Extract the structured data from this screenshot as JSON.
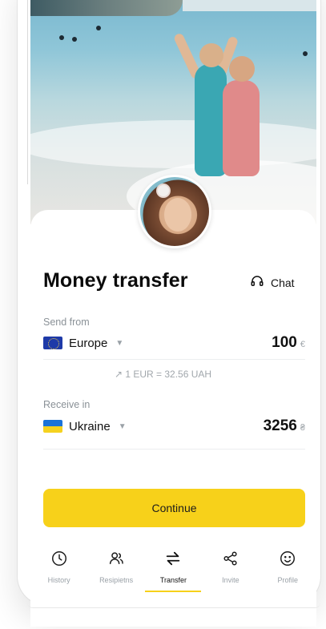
{
  "screen": {
    "title": "Money transfer",
    "chat_label": "Chat"
  },
  "send": {
    "label": "Send from",
    "region": "Europe",
    "amount": "100",
    "currency_symbol": "€",
    "flag_icon": "eu-flag-icon"
  },
  "rate": {
    "text": "1 EUR = 32.56 UAH"
  },
  "receive": {
    "label": "Receive in",
    "region": "Ukraine",
    "amount": "3256",
    "currency_symbol": "₴",
    "flag_icon": "ukraine-flag-icon"
  },
  "actions": {
    "continue_label": "Continue"
  },
  "tabbar": {
    "items": [
      {
        "label": "History",
        "icon": "clock-icon",
        "active": false
      },
      {
        "label": "Resipietns",
        "icon": "users-icon",
        "active": false
      },
      {
        "label": "Transfer",
        "icon": "transfer-arrows-icon",
        "active": true
      },
      {
        "label": "Invite",
        "icon": "share-icon",
        "active": false
      },
      {
        "label": "Profile",
        "icon": "smile-icon",
        "active": false
      }
    ]
  },
  "colors": {
    "accent": "#f7d11a",
    "text": "#0b0b0b",
    "muted": "#9aa1a7"
  }
}
